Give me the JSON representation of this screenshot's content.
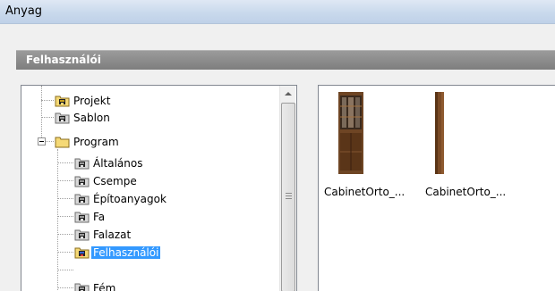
{
  "window": {
    "title": "Anyag"
  },
  "section": {
    "title": "Felhasználói"
  },
  "tree": {
    "items": [
      {
        "label": "Projekt"
      },
      {
        "label": "Sablon"
      },
      {
        "label": "Program",
        "expanded": true
      },
      {
        "label": "Általános"
      },
      {
        "label": "Csempe"
      },
      {
        "label": "Építoanyagok"
      },
      {
        "label": "Fa"
      },
      {
        "label": "Falazat"
      },
      {
        "label": "Felhasználói",
        "selected": true
      },
      {
        "label": "Fém"
      }
    ]
  },
  "thumbnails": {
    "items": [
      {
        "caption": "CabinetOrto_...",
        "icon": "cabinet-thumbnail"
      },
      {
        "caption": "CabinetOrto_...",
        "icon": "cabinet-thumbnail"
      }
    ]
  },
  "colors": {
    "selection": "#3399ff",
    "header": "#8a8a8a",
    "folder": "#f5d976"
  }
}
